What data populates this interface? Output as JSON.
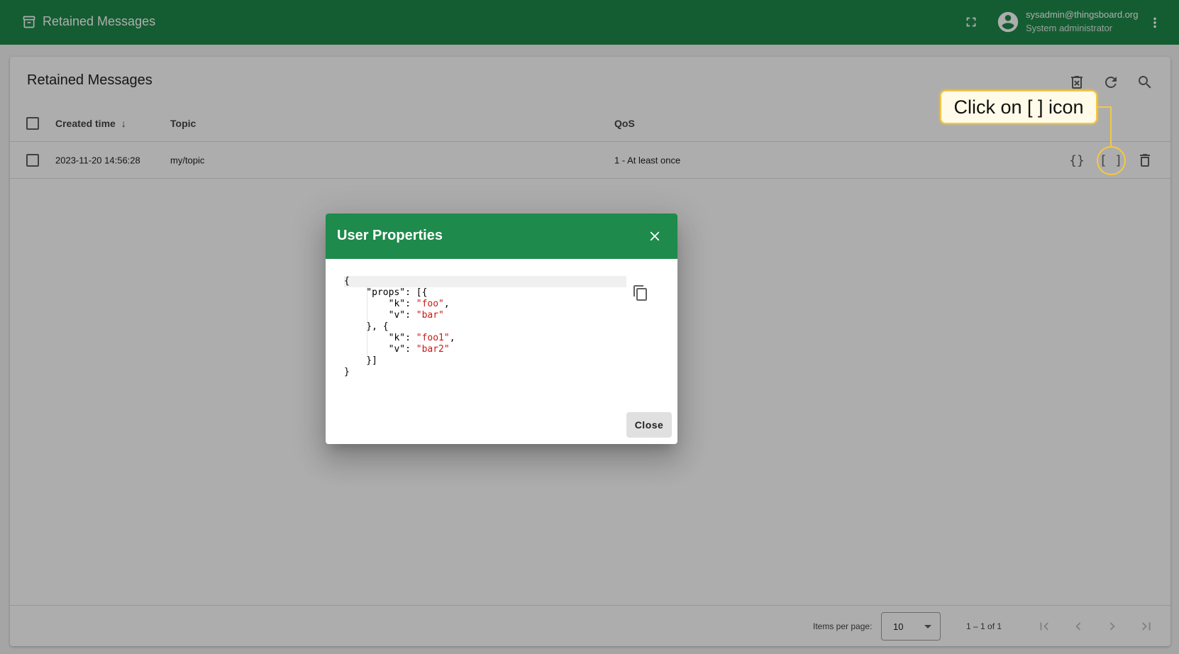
{
  "topbar": {
    "title": "Retained Messages",
    "user_email": "sysadmin@thingsboard.org",
    "user_role": "System administrator"
  },
  "card": {
    "title": "Retained Messages"
  },
  "table": {
    "columns": {
      "created_time": "Created time",
      "topic": "Topic",
      "qos": "QoS"
    },
    "sort_indicator": "↓",
    "rows": [
      {
        "created_time": "2023-11-20 14:56:28",
        "topic": "my/topic",
        "qos": "1 - At least once"
      }
    ],
    "row_action_payload_label": "{}",
    "row_action_user_props_label": "[ ]"
  },
  "paginator": {
    "items_per_page_label": "Items per page:",
    "items_per_page_value": "10",
    "range_label": "1 – 1 of 1"
  },
  "dialog": {
    "title": "User Properties",
    "json_lines": [
      "{",
      "    \"props\": [{",
      "        \"k\": ",
      "        \"v\": ",
      "    }, {",
      "        \"k\": ",
      "        \"v\": ",
      "    }]",
      "}"
    ],
    "json_strings": [
      "\"foo\"",
      "\"bar\"",
      "\"foo1\"",
      "\"bar2\""
    ],
    "json_tails": [
      ",",
      "",
      ",",
      ""
    ],
    "close_label": "Close"
  },
  "callout": {
    "text": "Click on [ ] icon",
    "color": "#f5c842"
  },
  "colors": {
    "primary": "#1e8a4b",
    "json_string": "#c41a16"
  }
}
